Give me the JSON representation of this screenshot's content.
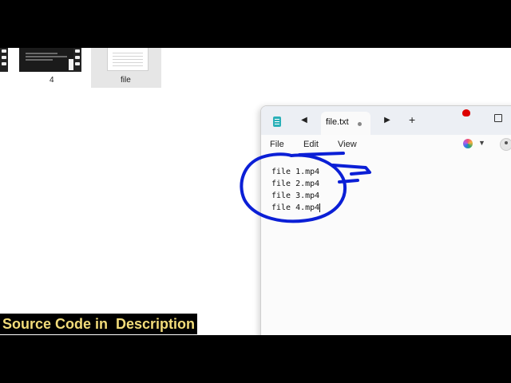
{
  "explorer": {
    "items": [
      {
        "label": "4",
        "icon": "video-thumbnail-icon"
      },
      {
        "label": "file",
        "icon": "text-file-icon"
      }
    ]
  },
  "notepad": {
    "tab": {
      "title": "file.txt",
      "modified_icon": "unsaved-dot-icon"
    },
    "menu": [
      "File",
      "Edit",
      "View"
    ],
    "icons": {
      "app": "notepad-icon",
      "back": "chevron-left-icon",
      "forward": "chevron-right-icon",
      "new_tab": "plus-icon",
      "bug": "ladybug-icon",
      "maximize": "maximize-icon",
      "copilot": "copilot-icon",
      "copilot_menu": "chevron-down-icon",
      "account": "account-icon"
    },
    "lines": [
      "file 1.mp4",
      "file 2.mp4",
      "file 3.mp4",
      "file 4.mp4"
    ]
  },
  "annotation": {
    "color": "#0b1fd6",
    "shape": "circle-and-arrow"
  },
  "caption": {
    "text": "Source Code in  Description",
    "color": "#f2dc7a"
  }
}
